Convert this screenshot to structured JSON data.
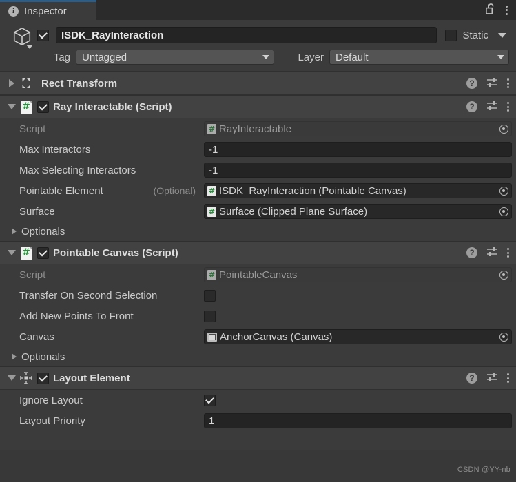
{
  "window": {
    "tab_label": "Inspector",
    "tab_icon": "info-icon",
    "lock_icon": "unlocked-padlock-icon",
    "menu_icon": "kebab-menu-icon",
    "accent_color": "#2c5d87"
  },
  "object_header": {
    "gameobject_icon": "cube-icon",
    "enabled": true,
    "name": "ISDK_RayInteraction",
    "static_enabled": false,
    "static_label": "Static",
    "tag_label": "Tag",
    "tag_value": "Untagged",
    "layer_label": "Layer",
    "layer_value": "Default"
  },
  "components": [
    {
      "title": "Rect Transform",
      "icon": "rect-transform-icon",
      "expanded": false,
      "has_enable_checkbox": false,
      "properties": []
    },
    {
      "title": "Ray Interactable (Script)",
      "icon": "csharp-script-icon",
      "expanded": true,
      "has_enable_checkbox": true,
      "enabled": true,
      "properties": [
        {
          "kind": "object",
          "label": "Script",
          "disabled": true,
          "icon": "csharp-script-icon",
          "value": "RayInteractable"
        },
        {
          "kind": "text",
          "label": "Max Interactors",
          "value": "-1"
        },
        {
          "kind": "text",
          "label": "Max Selecting Interactors",
          "value": "-1"
        },
        {
          "kind": "object",
          "label": "Pointable Element",
          "suffix": "(Optional)",
          "icon": "csharp-script-icon",
          "value": "ISDK_RayInteraction (Pointable Canvas)"
        },
        {
          "kind": "object",
          "label": "Surface",
          "icon": "csharp-script-icon",
          "value": "Surface (Clipped Plane Surface)"
        },
        {
          "kind": "foldout",
          "label": "Optionals",
          "expanded": false
        }
      ]
    },
    {
      "title": "Pointable Canvas (Script)",
      "icon": "csharp-script-icon",
      "expanded": true,
      "has_enable_checkbox": true,
      "enabled": true,
      "properties": [
        {
          "kind": "object",
          "label": "Script",
          "disabled": true,
          "icon": "csharp-script-icon",
          "value": "PointableCanvas"
        },
        {
          "kind": "checkbox",
          "label": "Transfer On Second Selection",
          "checked": false
        },
        {
          "kind": "checkbox",
          "label": "Add New Points To Front",
          "checked": false
        },
        {
          "kind": "object",
          "label": "Canvas",
          "icon": "canvas-icon",
          "value": "AnchorCanvas (Canvas)"
        },
        {
          "kind": "foldout",
          "label": "Optionals",
          "expanded": false
        }
      ]
    },
    {
      "title": "Layout Element",
      "icon": "layout-element-icon",
      "expanded": true,
      "has_enable_checkbox": true,
      "enabled": true,
      "properties": [
        {
          "kind": "checkbox",
          "label": "Ignore Layout",
          "checked": true
        },
        {
          "kind": "text",
          "label": "Layout Priority",
          "value": "1"
        }
      ]
    }
  ],
  "component_header_icons": {
    "help": "help-icon",
    "preset": "preset-slider-icon",
    "menu": "kebab-menu-icon"
  },
  "watermark": "CSDN @YY-nb"
}
